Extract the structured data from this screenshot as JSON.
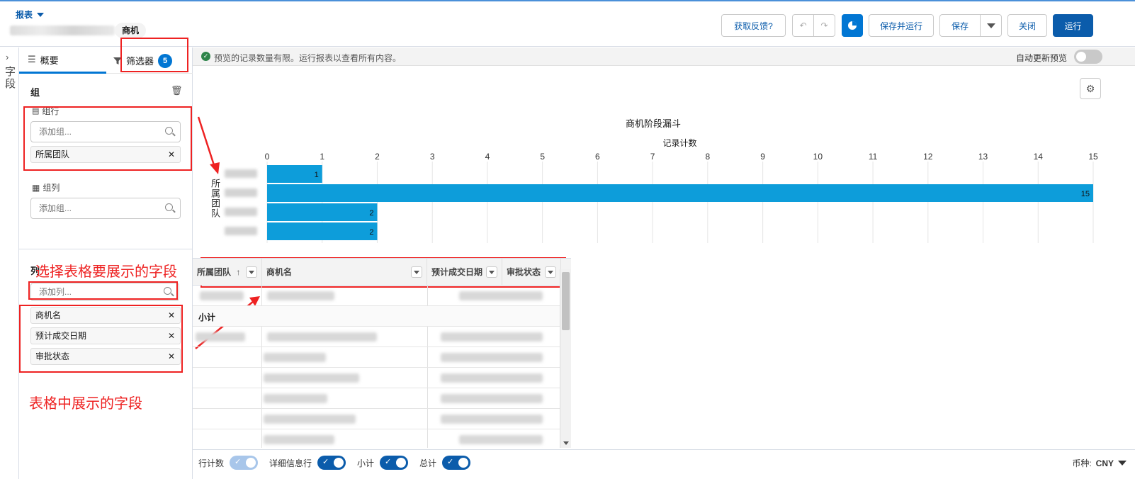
{
  "header": {
    "report_type": "报表",
    "entity": "商机",
    "buttons": {
      "feedback": "获取反馈?",
      "save_run": "保存并运行",
      "save": "保存",
      "close": "关闭",
      "run": "运行"
    }
  },
  "rail": {
    "label": "字段"
  },
  "left_panel": {
    "tabs": {
      "outline": "概要",
      "filters": "筛选器",
      "filter_count": "5"
    },
    "groups_title": "组",
    "group_rows": {
      "label": "组行",
      "placeholder": "添加组...",
      "items": [
        "所属团队"
      ]
    },
    "group_cols": {
      "label": "组列",
      "placeholder": "添加组..."
    },
    "columns": {
      "placeholder": "添加列...",
      "items": [
        "商机名",
        "预计成交日期",
        "审批状态"
      ]
    }
  },
  "annotations": {
    "select_fields": "选择表格要展示的字段",
    "fields_shown": "表格中展示的字段"
  },
  "notice": {
    "message": "预览的记录数量有限。运行报表以查看所有内容。",
    "auto_update": "自动更新预览"
  },
  "chart_data": {
    "type": "bar",
    "orientation": "horizontal",
    "title": "商机阶段漏斗",
    "xlabel": "记录计数",
    "ylabel": "所属团队",
    "xlim": [
      0,
      15
    ],
    "ticks": [
      0,
      1,
      2,
      3,
      4,
      5,
      6,
      7,
      8,
      9,
      10,
      11,
      12,
      13,
      14,
      15
    ],
    "values": [
      1,
      15,
      2,
      2
    ],
    "bar_color": "#0d9dda"
  },
  "table": {
    "headers": [
      "所属团队",
      "商机名",
      "预计成交日期",
      "审批状态"
    ],
    "sort_indicator": "↑",
    "subtotal": "小计"
  },
  "footer": {
    "row_counts": "行计数",
    "detail_rows": "详细信息行",
    "subtotals": "小计",
    "grand_total": "总计",
    "currency_label": "币种:",
    "currency_value": "CNY"
  }
}
